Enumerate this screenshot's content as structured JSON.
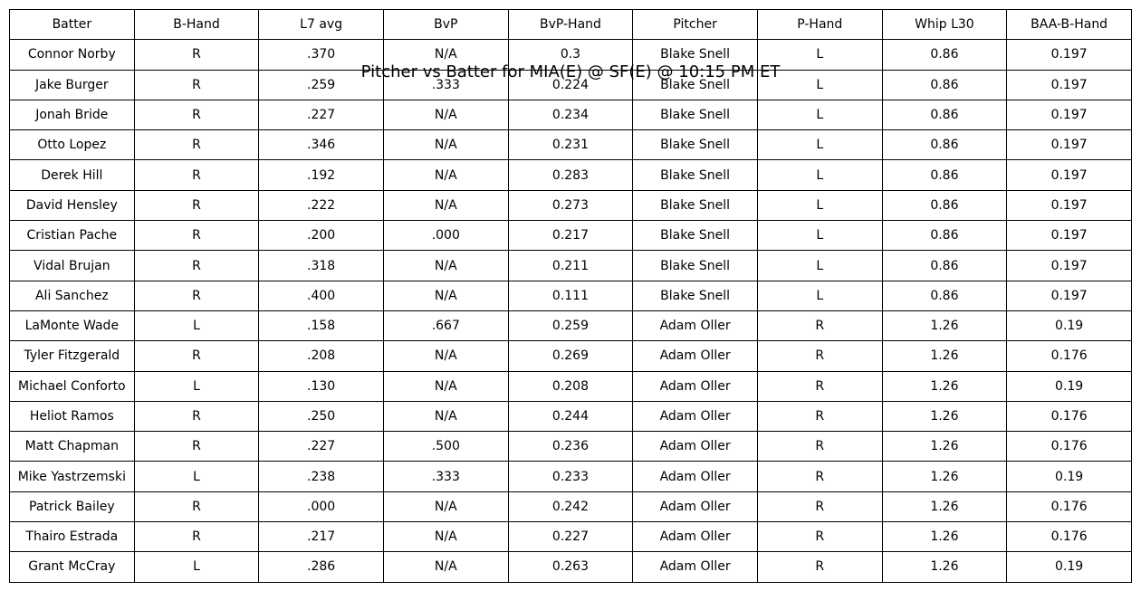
{
  "chart_data": {
    "type": "table",
    "title": "Pitcher vs Batter for MIA(E) @ SF(E) @ 10:15 PM ET",
    "columns": [
      "Batter",
      "B-Hand",
      "L7 avg",
      "BvP",
      "BvP-Hand",
      "Pitcher",
      "P-Hand",
      "Whip L30",
      "BAA-B-Hand"
    ],
    "rows": [
      [
        "Connor Norby",
        "R",
        ".370",
        "N/A",
        "0.3",
        "Blake Snell",
        "L",
        "0.86",
        "0.197"
      ],
      [
        "Jake Burger",
        "R",
        ".259",
        ".333",
        "0.224",
        "Blake Snell",
        "L",
        "0.86",
        "0.197"
      ],
      [
        "Jonah Bride",
        "R",
        ".227",
        "N/A",
        "0.234",
        "Blake Snell",
        "L",
        "0.86",
        "0.197"
      ],
      [
        "Otto Lopez",
        "R",
        ".346",
        "N/A",
        "0.231",
        "Blake Snell",
        "L",
        "0.86",
        "0.197"
      ],
      [
        "Derek Hill",
        "R",
        ".192",
        "N/A",
        "0.283",
        "Blake Snell",
        "L",
        "0.86",
        "0.197"
      ],
      [
        "David Hensley",
        "R",
        ".222",
        "N/A",
        "0.273",
        "Blake Snell",
        "L",
        "0.86",
        "0.197"
      ],
      [
        "Cristian Pache",
        "R",
        ".200",
        ".000",
        "0.217",
        "Blake Snell",
        "L",
        "0.86",
        "0.197"
      ],
      [
        "Vidal Brujan",
        "R",
        ".318",
        "N/A",
        "0.211",
        "Blake Snell",
        "L",
        "0.86",
        "0.197"
      ],
      [
        "Ali Sanchez",
        "R",
        ".400",
        "N/A",
        "0.111",
        "Blake Snell",
        "L",
        "0.86",
        "0.197"
      ],
      [
        "LaMonte Wade",
        "L",
        ".158",
        ".667",
        "0.259",
        "Adam Oller",
        "R",
        "1.26",
        "0.19"
      ],
      [
        "Tyler Fitzgerald",
        "R",
        ".208",
        "N/A",
        "0.269",
        "Adam Oller",
        "R",
        "1.26",
        "0.176"
      ],
      [
        "Michael Conforto",
        "L",
        ".130",
        "N/A",
        "0.208",
        "Adam Oller",
        "R",
        "1.26",
        "0.19"
      ],
      [
        "Heliot Ramos",
        "R",
        ".250",
        "N/A",
        "0.244",
        "Adam Oller",
        "R",
        "1.26",
        "0.176"
      ],
      [
        "Matt Chapman",
        "R",
        ".227",
        ".500",
        "0.236",
        "Adam Oller",
        "R",
        "1.26",
        "0.176"
      ],
      [
        "Mike Yastrzemski",
        "L",
        ".238",
        ".333",
        "0.233",
        "Adam Oller",
        "R",
        "1.26",
        "0.19"
      ],
      [
        "Patrick Bailey",
        "R",
        ".000",
        "N/A",
        "0.242",
        "Adam Oller",
        "R",
        "1.26",
        "0.176"
      ],
      [
        "Thairo Estrada",
        "R",
        ".217",
        "N/A",
        "0.227",
        "Adam Oller",
        "R",
        "1.26",
        "0.176"
      ],
      [
        "Grant McCray",
        "L",
        ".286",
        "N/A",
        "0.263",
        "Adam Oller",
        "R",
        "1.26",
        "0.19"
      ]
    ]
  }
}
